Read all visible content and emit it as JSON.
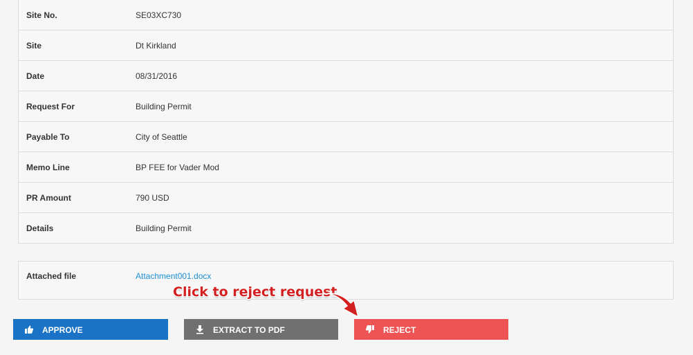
{
  "details": [
    {
      "label": "Site No.",
      "value": "SE03XC730"
    },
    {
      "label": "Site",
      "value": "Dt Kirkland"
    },
    {
      "label": "Date",
      "value": "08/31/2016"
    },
    {
      "label": "Request For",
      "value": "Building Permit"
    },
    {
      "label": "Payable To",
      "value": "City of Seattle"
    },
    {
      "label": "Memo Line",
      "value": "BP FEE for Vader Mod"
    },
    {
      "label": "PR Amount",
      "value": "790 USD"
    },
    {
      "label": "Details",
      "value": "Building Permit"
    }
  ],
  "attachment": {
    "label": "Attached file",
    "file_name": "Attachment001.docx"
  },
  "annotation": {
    "text": "Click to reject request",
    "color": "#d32020"
  },
  "actions": {
    "approve_label": "APPROVE",
    "approve_icon": "thumbs-up-icon",
    "approve_color": "#1a73c7",
    "extract_label": "EXTRACT TO PDF",
    "extract_icon": "download-icon",
    "extract_color": "#707070",
    "reject_label": "REJECT",
    "reject_icon": "thumbs-down-icon",
    "reject_color": "#ee5454"
  }
}
